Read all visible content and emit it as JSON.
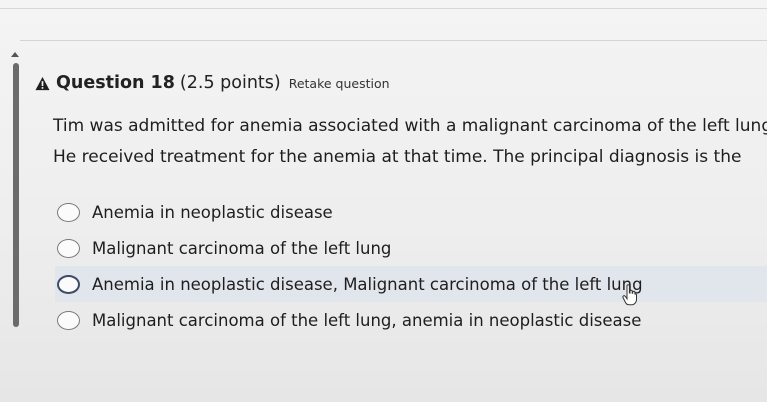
{
  "question": {
    "title": "Question 18",
    "points": "(2.5 points)",
    "retake_label": "Retake question",
    "icon": "warning-triangle-icon",
    "prompt_lines": [
      "Tim was admitted for anemia associated with a malignant carcinoma of the left lung.",
      "He received treatment for the anemia at that time. The principal diagnosis is the"
    ],
    "options": [
      {
        "label": "Anemia in neoplastic disease",
        "selected": false,
        "hovered": false
      },
      {
        "label": "Malignant carcinoma of the left lung",
        "selected": false,
        "hovered": false
      },
      {
        "label": "Anemia in neoplastic disease, Malignant carcinoma of the left lung",
        "selected": false,
        "hovered": true
      },
      {
        "label": "Malignant carcinoma of the left lung, anemia in neoplastic disease",
        "selected": false,
        "hovered": false
      }
    ]
  },
  "colors": {
    "warning": "#1f1f1f",
    "hover_row": "#e1e5ec",
    "scrollbar": "#6b6b6b"
  }
}
